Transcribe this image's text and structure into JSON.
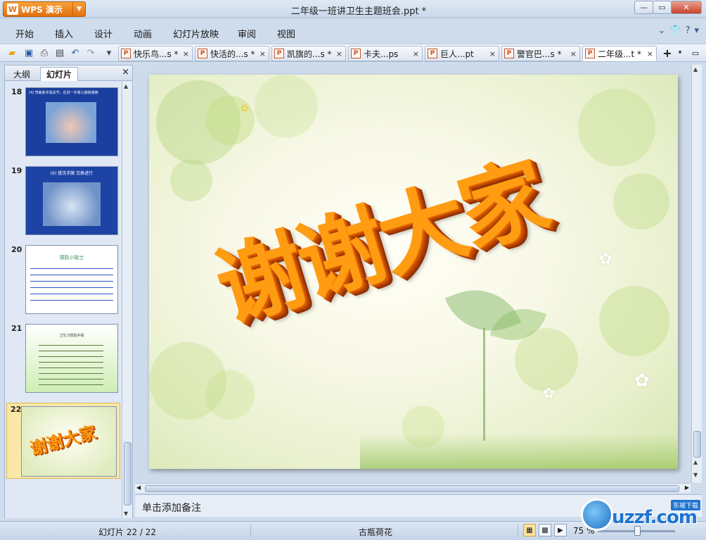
{
  "app": {
    "button_label": "WPS 演示",
    "logo_glyph": "W",
    "window_title": "二年级一班讲卫生主题班会.ppt *"
  },
  "menu": {
    "items": [
      "开始",
      "插入",
      "设计",
      "动画",
      "幻灯片放映",
      "审阅",
      "视图"
    ]
  },
  "tabs": [
    {
      "label": "快乐鸟...s *",
      "active": false
    },
    {
      "label": "快活的...s *",
      "active": false
    },
    {
      "label": "凯旗的...s *",
      "active": false
    },
    {
      "label": "卡夫...ps",
      "active": false
    },
    {
      "label": "巨人...pt",
      "active": false
    },
    {
      "label": "警官巴...s *",
      "active": false
    },
    {
      "label": "二年级...t *",
      "active": true
    }
  ],
  "left_pane": {
    "tab_outline": "大纲",
    "tab_slides": "幻灯片",
    "close_glyph": "×",
    "thumbs": [
      {
        "number": "18",
        "caption": "(4) 弯曲各手指关节，在另一手掌心旋转搓擦"
      },
      {
        "number": "19",
        "caption": "(6) 搓洗手腕 交换进行"
      },
      {
        "number": "20",
        "caption": "预防小贴士"
      },
      {
        "number": "21",
        "caption": "卫生习惯拍手歌"
      },
      {
        "number": "22",
        "caption": "谢谢大家"
      }
    ]
  },
  "slide": {
    "text": "谢谢大家"
  },
  "notes": {
    "placeholder": "单击添加备注"
  },
  "status": {
    "slide_counter": "幻灯片 22 / 22",
    "theme_name": "古瓶荷花",
    "zoom": "75 %"
  },
  "watermark": {
    "text": "uzzf.com",
    "tag": "东坡下载"
  },
  "colors": {
    "accent": "#e1700f",
    "title_orange": "#ff9c12",
    "chrome_blue": "#cfdcec"
  }
}
